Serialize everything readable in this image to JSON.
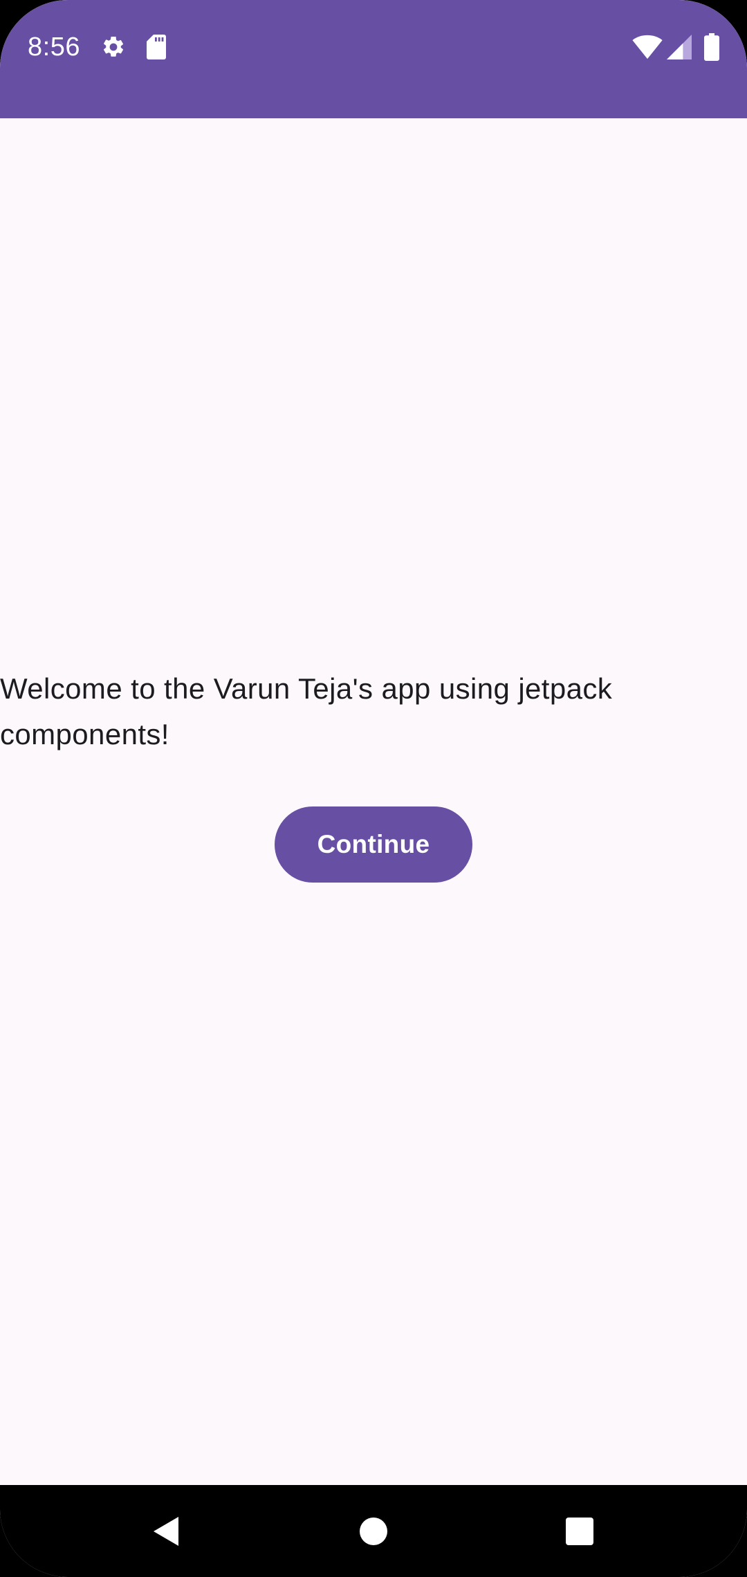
{
  "status_bar": {
    "time": "8:56",
    "icons": [
      "gear-icon",
      "sd-card-icon",
      "wifi-icon",
      "signal-icon",
      "battery-icon"
    ],
    "background_color": "#6750a4"
  },
  "main": {
    "welcome_text": "Welcome to the Varun Teja's app using jetpack components!",
    "continue_label": "Continue",
    "accent_color": "#6750a4",
    "background_color": "#fdf8fc"
  },
  "nav_bar": {
    "icons": [
      "back-icon",
      "home-icon",
      "recents-icon"
    ]
  }
}
